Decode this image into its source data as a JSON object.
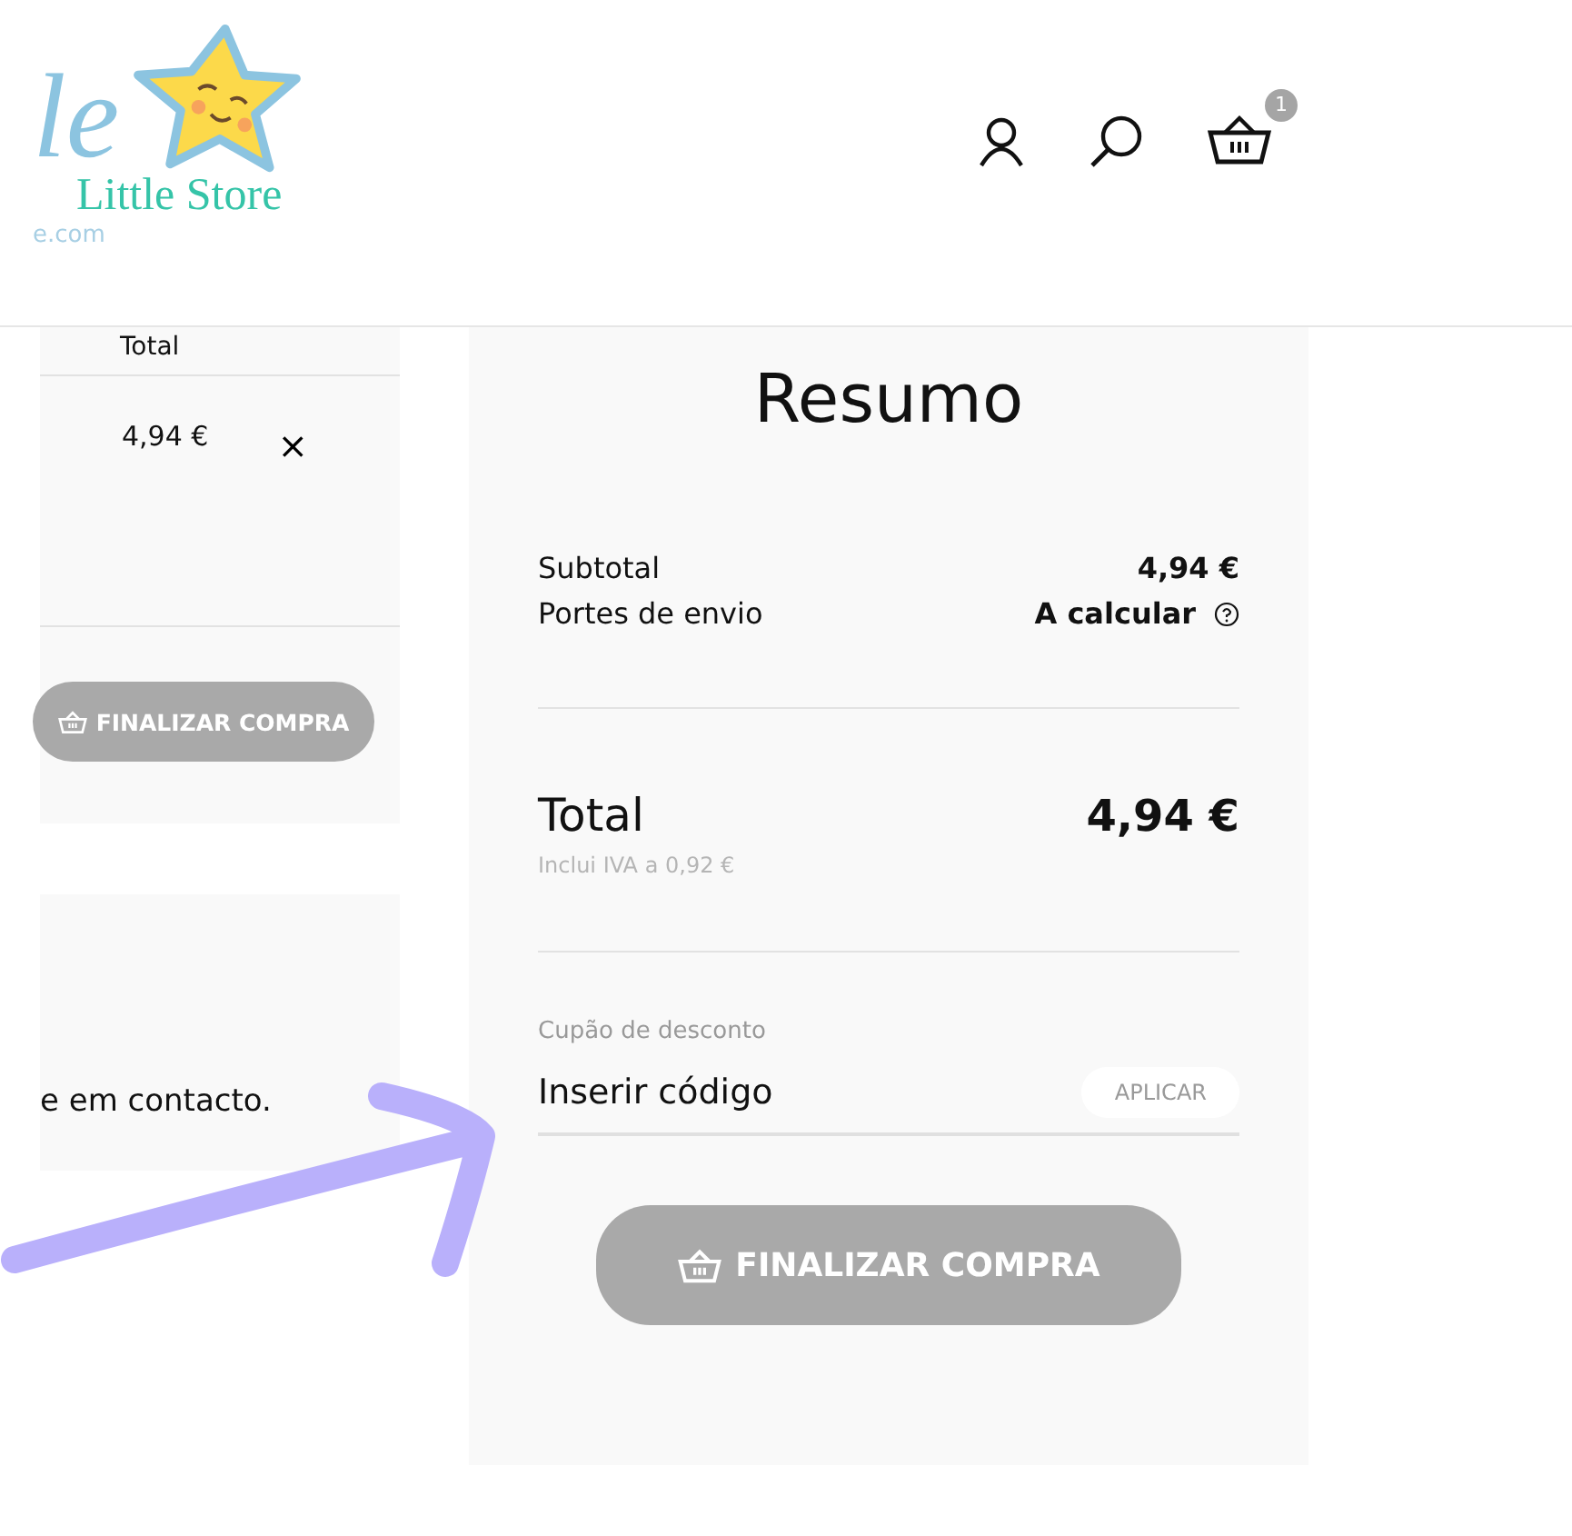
{
  "logo": {
    "script_letters": "le",
    "name": "Little Store",
    "domain": "e.com"
  },
  "header": {
    "cart_count": "1"
  },
  "cart": {
    "column_heading": "Total",
    "item_total": "4,94 €",
    "remove": "×",
    "checkout": "FINALIZAR COMPRA"
  },
  "notice": {
    "text": "e em contacto."
  },
  "summary": {
    "title": "Resumo",
    "lines": [
      {
        "label": "Subtotal",
        "value": "4,94 €",
        "help": false
      },
      {
        "label": "Portes de envio",
        "value": "A calcular",
        "help": true
      }
    ],
    "total_label": "Total",
    "total_value": "4,94 €",
    "tax_note": "Inclui IVA a 0,92 €",
    "coupon": {
      "label": "Cupão de desconto",
      "placeholder": "Inserir código",
      "apply": "APLICAR"
    },
    "checkout": "FINALIZAR COMPRA"
  }
}
